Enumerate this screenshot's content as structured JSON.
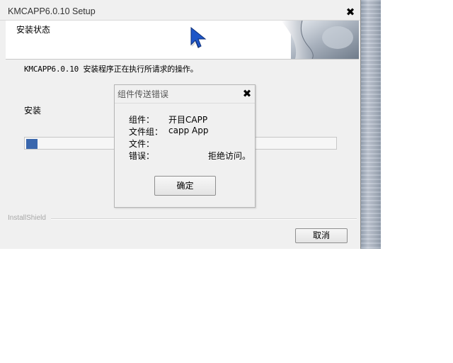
{
  "window": {
    "title": "KMCAPP6.0.10 Setup",
    "close_glyph": "✖"
  },
  "banner": {
    "title": "安装状态"
  },
  "main": {
    "description": "KMCAPP6.0.10 安装程序正在执行所请求的操作。",
    "status_label": "安装",
    "progress_fraction": 0.04,
    "brand": "InstallShield",
    "cancel_label": "取消"
  },
  "dialog": {
    "title": "组件传送错误",
    "close_glyph": "✖",
    "component_label": "组件：",
    "component_value": "开目CAPP",
    "filegroup_label": "文件组：",
    "filegroup_value": "capp App",
    "file_label": "文件：",
    "file_value": "",
    "error_label": "错误：",
    "error_value": "拒绝访问。",
    "ok_label": "确定"
  },
  "colors": {
    "progress": "#3a67ad",
    "cursor": "#1f56c7"
  },
  "icons": {
    "cursor": "mouse-pointer-icon",
    "banner_art": "page-curl-graphic"
  }
}
